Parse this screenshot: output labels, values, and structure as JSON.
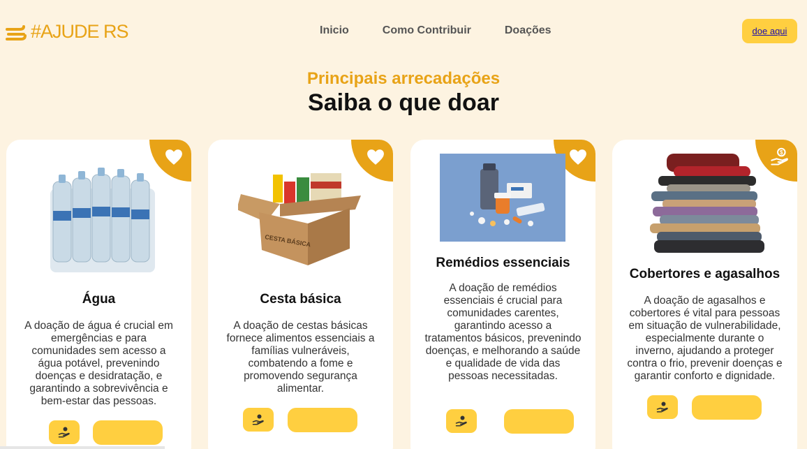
{
  "header": {
    "logo_text": "#AJUDE RS",
    "nav": [
      "Inicio",
      "Como Contribuir",
      "Doações"
    ],
    "donate_label": "doe aqui"
  },
  "section": {
    "kicker": "Principais arrecadações",
    "heading": "Saiba o que doar"
  },
  "cards": [
    {
      "title": "Água",
      "text": "A doação de água é crucial em emergências e para comunidades sem acesso a água potável, prevenindo doenças e desidratação, e garantindo a sobrevivência e bem-estar das pessoas.",
      "badge_icon": "heart-icon"
    },
    {
      "title": "Cesta básica",
      "text": "A doação de cestas básicas fornece alimentos essenciais a famílias vulneráveis, combatendo a fome e promovendo segurança alimentar.",
      "badge_icon": "heart-icon",
      "box_label": "CESTA BÁSICA"
    },
    {
      "title": "Remédios essenciais",
      "text": "A doação de remédios essenciais é crucial para comunidades carentes, garantindo acesso a tratamentos básicos, prevenindo doenças, e melhorando a saúde e qualidade de vida das pessoas necessitadas.",
      "badge_icon": "heart-icon"
    },
    {
      "title": "Cobertores e agasalhos",
      "text": "A doação de agasalhos e cobertores é vital para pessoas em situação de vulnerabilidade, especialmente durante o inverno, ajudando a proteger contra o frio, prevenir doenças e garantir conforto e dignidade.",
      "badge_icon": "hand-coin-icon"
    }
  ],
  "colors": {
    "background": "#fdf3e1",
    "accent": "#e8a317",
    "button": "#ffcf40"
  }
}
